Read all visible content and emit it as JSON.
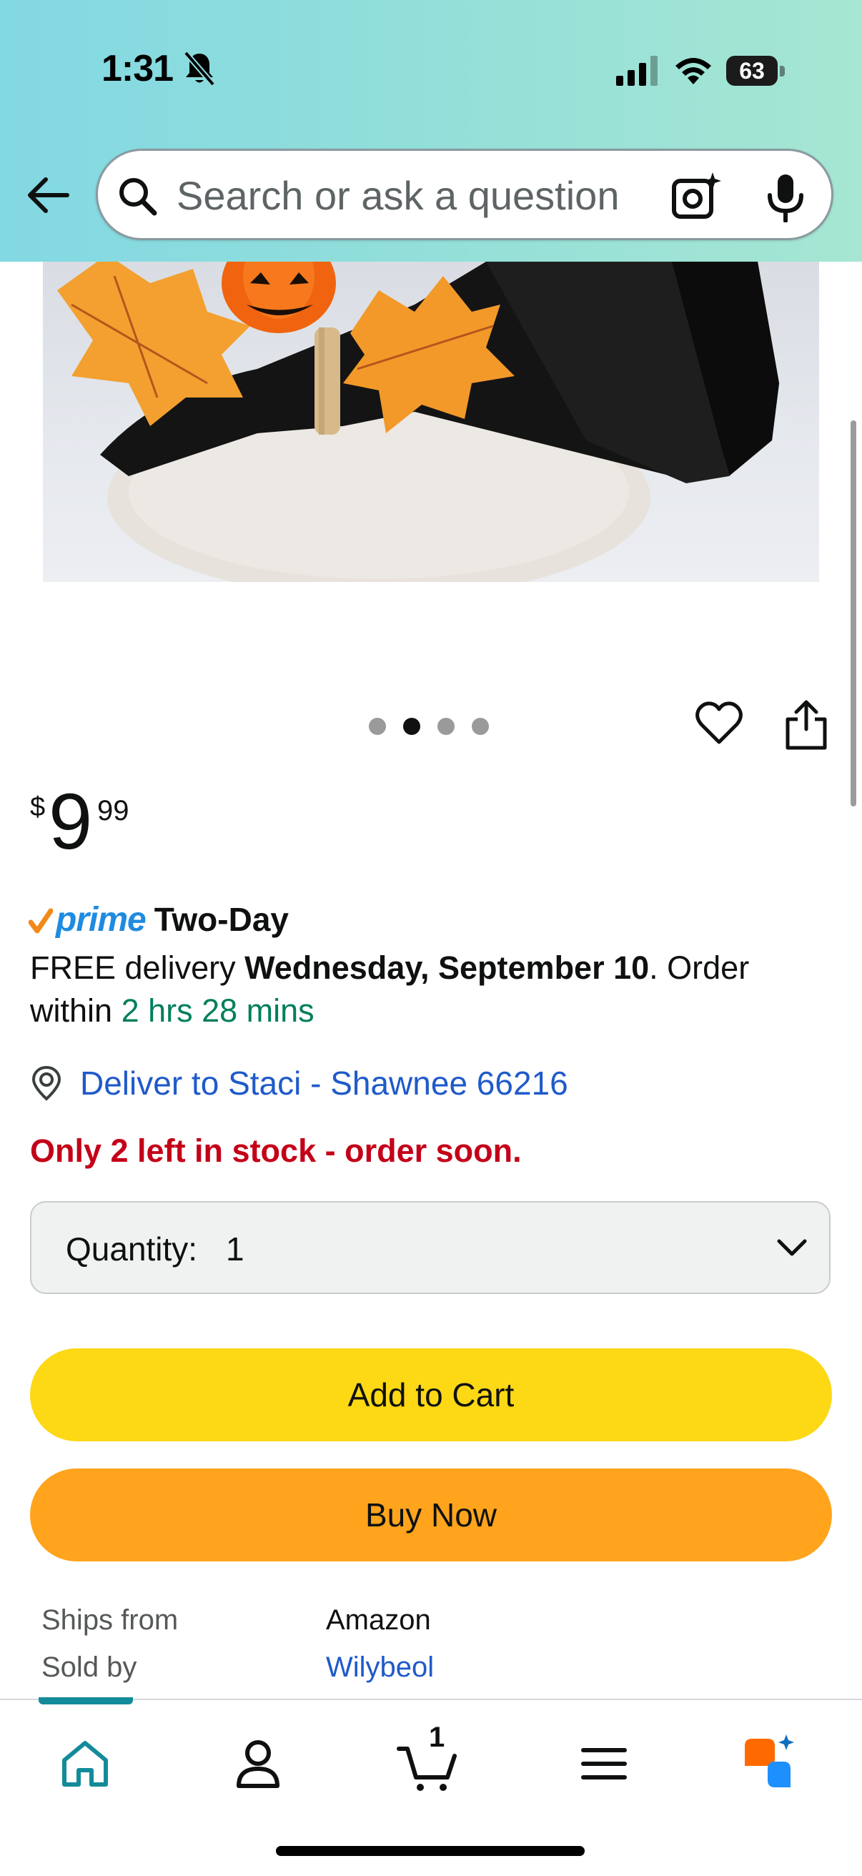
{
  "status_bar": {
    "time": "1:31",
    "battery": "63",
    "icons": [
      "bell-muted-icon",
      "cellular-signal-icon",
      "wifi-icon",
      "battery-icon"
    ]
  },
  "header": {
    "back_icon": "back-arrow-icon",
    "search": {
      "placeholder": "Search or ask a question",
      "value": "",
      "icons": [
        "search-icon",
        "camera-lens-icon",
        "microphone-icon"
      ]
    }
  },
  "gallery": {
    "image_count": 4,
    "active_index": 1,
    "actions": [
      "heart-icon",
      "share-icon"
    ]
  },
  "price": {
    "symbol": "$",
    "whole": "9",
    "fraction": "99"
  },
  "delivery": {
    "prime_label": "prime",
    "speed": "Two-Day",
    "line_prefix": "FREE delivery ",
    "date": "Wednesday, September 10",
    "line_mid": ". Order within ",
    "countdown": "2 hrs 28 mins",
    "deliver_to": "Deliver to Staci - Shawnee 66216"
  },
  "stock": {
    "message": "Only 2 left in stock - order soon."
  },
  "quantity": {
    "label": "Quantity:",
    "value": "1"
  },
  "buttons": {
    "add_to_cart": "Add to Cart",
    "buy_now": "Buy Now"
  },
  "seller_info": {
    "ships_from_label": "Ships from",
    "ships_from_value": "Amazon",
    "sold_by_label": "Sold by",
    "sold_by_value": "Wilybeol"
  },
  "bottom_nav": {
    "items": [
      "home-icon",
      "account-icon",
      "cart-icon",
      "menu-icon",
      "rufus-icon"
    ],
    "active": "home",
    "cart_count": "1"
  },
  "colors": {
    "header_gradient_start": "#82d8e3",
    "header_gradient_end": "#a6e6d2",
    "add_to_cart": "#fdd814",
    "buy_now": "#ffa41c",
    "link": "#1f5ac9",
    "stock_warning": "#c40018",
    "countdown": "#007e5c",
    "prime": "#1f8be0",
    "nav_active": "#138b99"
  }
}
